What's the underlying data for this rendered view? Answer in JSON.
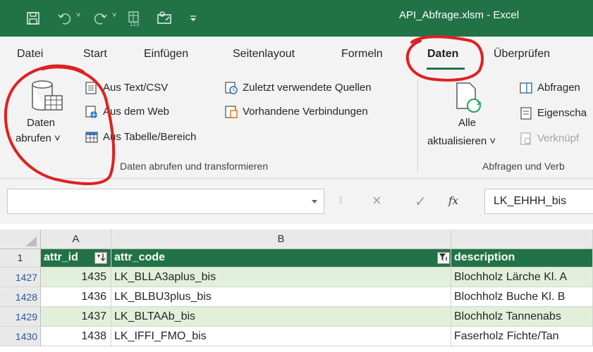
{
  "window": {
    "title": "API_Abfrage.xlsm  -  Excel"
  },
  "tabs": [
    "Datei",
    "Start",
    "Einfügen",
    "Seitenlayout",
    "Formeln",
    "Daten",
    "Überprüfen"
  ],
  "active_tab": "Daten",
  "ribbon": {
    "get_data": {
      "line1": "Daten",
      "line2": "abrufen ˅"
    },
    "from_text_csv": "Aus Text/CSV",
    "from_web": "Aus dem Web",
    "from_table": "Aus Tabelle/Bereich",
    "recent_sources": "Zuletzt verwendete Quellen",
    "existing_connections": "Vorhandene Verbindungen",
    "group1_label": "Daten abrufen und transformieren",
    "refresh_all": {
      "line1": "Alle",
      "line2": "aktualisieren ˅"
    },
    "queries": "Abfragen",
    "properties": "Eigenscha",
    "edit_links": "Verknüpf",
    "group2_label": "Abfragen und Verb"
  },
  "formula_bar": {
    "cancel_icon": "×",
    "enter_icon": "✓",
    "fx_label": "fx",
    "value": "LK_EHHH_bis"
  },
  "columns": [
    "A",
    "B"
  ],
  "header_row": {
    "row_number": "1",
    "attr_id": "attr_id",
    "attr_code": "attr_code",
    "description": "description"
  },
  "rows": [
    {
      "row_number": "1427",
      "attr_id": "1435",
      "attr_code": "LK_BLLA3aplus_bis",
      "description": "Blochholz Lärche Kl. A"
    },
    {
      "row_number": "1428",
      "attr_id": "1436",
      "attr_code": "LK_BLBU3plus_bis",
      "description": "Blochholz Buche Kl. B"
    },
    {
      "row_number": "1429",
      "attr_id": "1437",
      "attr_code": "LK_BLTAAb_bis",
      "description": "Blochholz Tannenabs"
    },
    {
      "row_number": "1430",
      "attr_id": "1438",
      "attr_code": "LK_IFFI_FMO_bis",
      "description": "Faserholz Fichte/Tan"
    }
  ],
  "colors": {
    "excel_green": "#217346",
    "band_green": "#e2efda",
    "annotation_red": "#e02020"
  }
}
